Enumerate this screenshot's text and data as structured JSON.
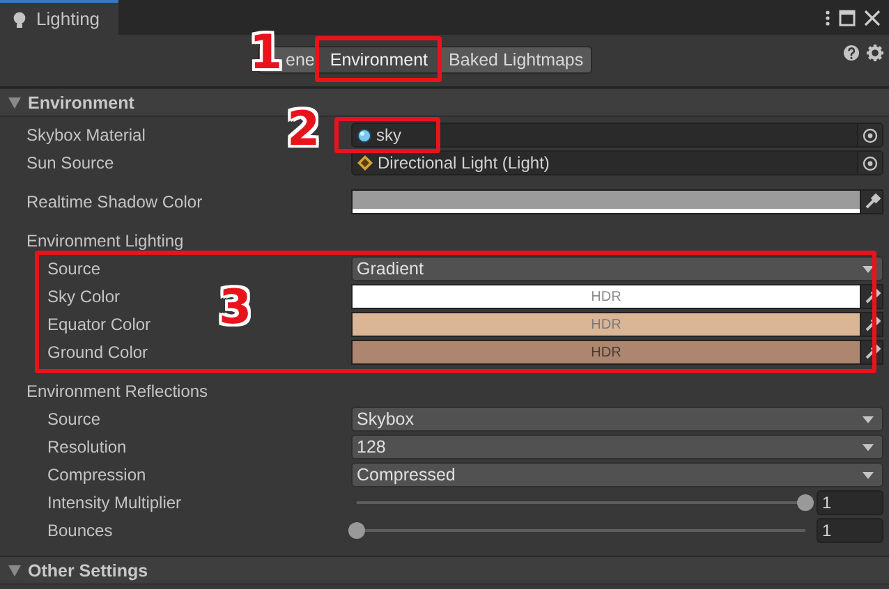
{
  "window": {
    "title": "Lighting"
  },
  "toolbar": {
    "tabs": [
      {
        "label": "ene",
        "selected": false
      },
      {
        "label": "Environment",
        "selected": true
      },
      {
        "label": "Baked Lightmaps",
        "selected": false
      }
    ]
  },
  "sections": [
    {
      "title": "Environment",
      "expanded": true,
      "rows": [
        {
          "kind": "material",
          "label": "Skybox Material",
          "value": "sky"
        },
        {
          "kind": "light",
          "label": "Sun Source",
          "value": "Directional Light (Light)"
        },
        {
          "kind": "color",
          "label": "Realtime Shadow Color",
          "color": "#9b9b9b"
        },
        {
          "kind": "heading",
          "label": "Environment Lighting",
          "children": [
            {
              "kind": "dropdown",
              "label": "Source",
              "value": "Gradient"
            },
            {
              "kind": "color",
              "label": "Sky Color",
              "color": "#ffffff",
              "badge": "HDR"
            },
            {
              "kind": "color",
              "label": "Equator Color",
              "color": "#dab697",
              "badge": "HDR"
            },
            {
              "kind": "color",
              "label": "Ground Color",
              "color": "#ad8670",
              "badge": "HDR"
            }
          ]
        },
        {
          "kind": "heading",
          "label": "Environment Reflections",
          "children": [
            {
              "kind": "dropdown",
              "label": "Source",
              "value": "Skybox"
            },
            {
              "kind": "dropdown",
              "label": "Resolution",
              "value": "128"
            },
            {
              "kind": "dropdown",
              "label": "Compression",
              "value": "Compressed"
            },
            {
              "kind": "slider",
              "label": "Intensity Multiplier",
              "level": 1,
              "value": "1"
            },
            {
              "kind": "slider",
              "label": "Bounces",
              "level": 0,
              "value": "1"
            }
          ]
        }
      ]
    },
    {
      "title": "Other Settings",
      "expanded": true
    }
  ],
  "annotations": [
    {
      "label": "1"
    },
    {
      "label": "2"
    },
    {
      "label": "3"
    }
  ]
}
